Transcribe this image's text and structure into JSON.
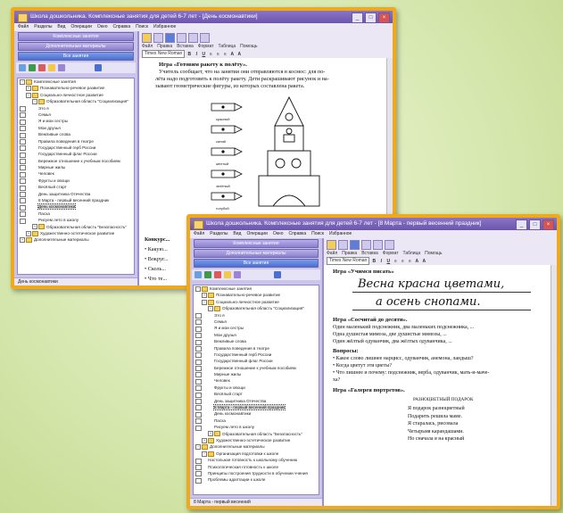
{
  "back_window": {
    "title": "Школа дошкольника. Комплексные занятия для детей 6-7 лет - [День космонавтики]",
    "menu": [
      "Файл",
      "Разделы",
      "Вид",
      "Операции",
      "Окно",
      "Справка",
      "Поиск",
      "Избранное"
    ],
    "left_buttons": [
      "Комплексные занятия",
      "Дополнительные материалы",
      "Все занятия"
    ],
    "tree": [
      {
        "label": "Комплексные занятия",
        "level": 0,
        "type": "folder",
        "toggle": "−"
      },
      {
        "label": "Познавательно-речевое развитие",
        "level": 1,
        "type": "folder",
        "toggle": "+"
      },
      {
        "label": "Социально-личностное развитие",
        "level": 1,
        "type": "folder",
        "toggle": "−"
      },
      {
        "label": "Образовательная область \"Социализация\"",
        "level": 2,
        "type": "folder",
        "toggle": "−"
      },
      {
        "label": "Это я",
        "level": 3,
        "type": "doc"
      },
      {
        "label": "Семья",
        "level": 3,
        "type": "doc"
      },
      {
        "label": "Я и мои сестры",
        "level": 3,
        "type": "doc"
      },
      {
        "label": "Мои друзья",
        "level": 3,
        "type": "doc"
      },
      {
        "label": "Вежливые слова",
        "level": 3,
        "type": "doc"
      },
      {
        "label": "Правила поведения в театре",
        "level": 3,
        "type": "doc"
      },
      {
        "label": "Государственный герб России",
        "level": 3,
        "type": "doc"
      },
      {
        "label": "Государственный флаг России",
        "level": 3,
        "type": "doc"
      },
      {
        "label": "Бережное отношение к учебным пособиям",
        "level": 3,
        "type": "doc"
      },
      {
        "label": "Мирные жилы",
        "level": 3,
        "type": "doc"
      },
      {
        "label": "Человек",
        "level": 3,
        "type": "doc"
      },
      {
        "label": "Фрукты и овощи",
        "level": 3,
        "type": "doc"
      },
      {
        "label": "Весёлый старт",
        "level": 3,
        "type": "doc"
      },
      {
        "label": "День защитника Отечества",
        "level": 3,
        "type": "doc"
      },
      {
        "label": "8 Марта - первый весенний праздник",
        "level": 3,
        "type": "doc"
      },
      {
        "label": "День космонавтики",
        "level": 3,
        "type": "doc",
        "selected": true
      },
      {
        "label": "Пасха",
        "level": 3,
        "type": "doc"
      },
      {
        "label": "Рисуем лето в школу",
        "level": 3,
        "type": "doc"
      },
      {
        "label": "Образовательная область \"Безопасность\"",
        "level": 2,
        "type": "folder",
        "toggle": "+"
      },
      {
        "label": "Художественно-эстетическое развитие",
        "level": 1,
        "type": "folder",
        "toggle": "+"
      },
      {
        "label": "Дополнительные материалы",
        "level": 0,
        "type": "folder",
        "toggle": "+"
      }
    ],
    "status": "День космонавтики",
    "doc_menu": [
      "Файл",
      "Правка",
      "Вставка",
      "Формат",
      "Таблица",
      "Помощь"
    ],
    "font_name": "Times New Roman",
    "doc": {
      "heading": "Игра «Готовим ракету к полёту».",
      "para": [
        "Учитель сообщает, что на занятии они отправляются в космос: для по-",
        "лёта надо подготовить к полёту ракету. Дети раскрашивают рисунок и на-",
        "зывают геометрические фигуры, из которых составлена ракета."
      ],
      "pencils": [
        "красный",
        "синий",
        "жёлтый",
        "зелёный",
        "голубой"
      ],
      "bullets": [
        "Конкурс...",
        "• Какую...",
        "• Вокруг...",
        "• Сколь...",
        "• Что те..."
      ]
    }
  },
  "front_window": {
    "title": "Школа дошкольника. Комплексные занятия для детей 6-7 лет - [8 Марта - первый весенний праздник]",
    "menu": [
      "Файл",
      "Разделы",
      "Вид",
      "Операции",
      "Окно",
      "Справка",
      "Поиск",
      "Избранное"
    ],
    "left_buttons": [
      "Комплексные занятия",
      "Дополнительные материалы",
      "Все занятия"
    ],
    "tree": [
      {
        "label": "Комплексные занятия",
        "level": 0,
        "type": "folder",
        "toggle": "−"
      },
      {
        "label": "Познавательно-речевое развитие",
        "level": 1,
        "type": "folder",
        "toggle": "+"
      },
      {
        "label": "Социально-личностное развитие",
        "level": 1,
        "type": "folder",
        "toggle": "−"
      },
      {
        "label": "Образовательная область \"Социализация\"",
        "level": 2,
        "type": "folder",
        "toggle": "−"
      },
      {
        "label": "Это я",
        "level": 3,
        "type": "doc"
      },
      {
        "label": "Семья",
        "level": 3,
        "type": "doc"
      },
      {
        "label": "Я и мои сестры",
        "level": 3,
        "type": "doc"
      },
      {
        "label": "Мои друзья",
        "level": 3,
        "type": "doc"
      },
      {
        "label": "Вежливые слова",
        "level": 3,
        "type": "doc"
      },
      {
        "label": "Правила поведения в театре",
        "level": 3,
        "type": "doc"
      },
      {
        "label": "Государственный герб России",
        "level": 3,
        "type": "doc"
      },
      {
        "label": "Государственный флаг России",
        "level": 3,
        "type": "doc"
      },
      {
        "label": "Бережное отношение к учебным пособиям",
        "level": 3,
        "type": "doc"
      },
      {
        "label": "Мирные жилы",
        "level": 3,
        "type": "doc"
      },
      {
        "label": "Человек",
        "level": 3,
        "type": "doc"
      },
      {
        "label": "Фрукты и овощи",
        "level": 3,
        "type": "doc"
      },
      {
        "label": "Весёлый старт",
        "level": 3,
        "type": "doc"
      },
      {
        "label": "День защитника Отечества",
        "level": 3,
        "type": "doc"
      },
      {
        "label": "8 Марта - первый весенний праздник",
        "level": 3,
        "type": "doc",
        "selected": true
      },
      {
        "label": "День космонавтики",
        "level": 3,
        "type": "doc"
      },
      {
        "label": "Пасха",
        "level": 3,
        "type": "doc"
      },
      {
        "label": "Рисуем лето в школу",
        "level": 3,
        "type": "doc"
      },
      {
        "label": "Образовательная область \"Безопасность\"",
        "level": 2,
        "type": "folder",
        "toggle": "+"
      },
      {
        "label": "Художественно-эстетическое развитие",
        "level": 1,
        "type": "folder",
        "toggle": "+"
      },
      {
        "label": "Дополнительные материалы",
        "level": 0,
        "type": "folder",
        "toggle": "−"
      },
      {
        "label": "Организация подготовки к школе",
        "level": 1,
        "type": "folder",
        "toggle": "−"
      },
      {
        "label": "Настольная готовность к школьному обучению",
        "level": 2,
        "type": "doc"
      },
      {
        "label": "Психологическая готовность к школе",
        "level": 2,
        "type": "doc"
      },
      {
        "label": "Принципы построения трудности в обучении ччения",
        "level": 2,
        "type": "doc"
      },
      {
        "label": "Проблемы адаптации к школе",
        "level": 2,
        "type": "doc"
      }
    ],
    "status": "8 Марта - первый весенний",
    "doc_menu": [
      "Файл",
      "Правка",
      "Вставка",
      "Формат",
      "Таблица",
      "Помощь"
    ],
    "font_name": "Times New Roman",
    "doc": {
      "h1": "Игра «Учимся писать»",
      "hand1": "Весна красна цветами,",
      "hand2": "а осень снопами.",
      "h2": "Игра «Сосчитай до десяти».",
      "count": [
        "Один маленький подснежник, два маленьких подснежника, ...",
        "Одна душистая мимоза, две душистые мимозы, ...",
        "Один жёлтый одуванчик, два жёлтых одуванчика, ..."
      ],
      "h3": "Вопросы:",
      "q": [
        "• Какое слово лишнее нарцисс, одуванчик, анемона, ландыш?",
        "• Когда цветут эти цветы?",
        "• Что лишнее и почему: подснежник, верба, одуванчик, мать-и-маче-",
        "ха?"
      ],
      "h4": "Игра «Галерея портретов».",
      "poem_title": "РАЗНОЦВЕТНЫЙ ПОДАРОК",
      "poem": [
        "Я подарок разноцветный",
        "Подарить решила маме.",
        "Я старалась, рисовала",
        "Четырьмя карандашами.",
        "Но сначала я на красный"
      ]
    }
  }
}
